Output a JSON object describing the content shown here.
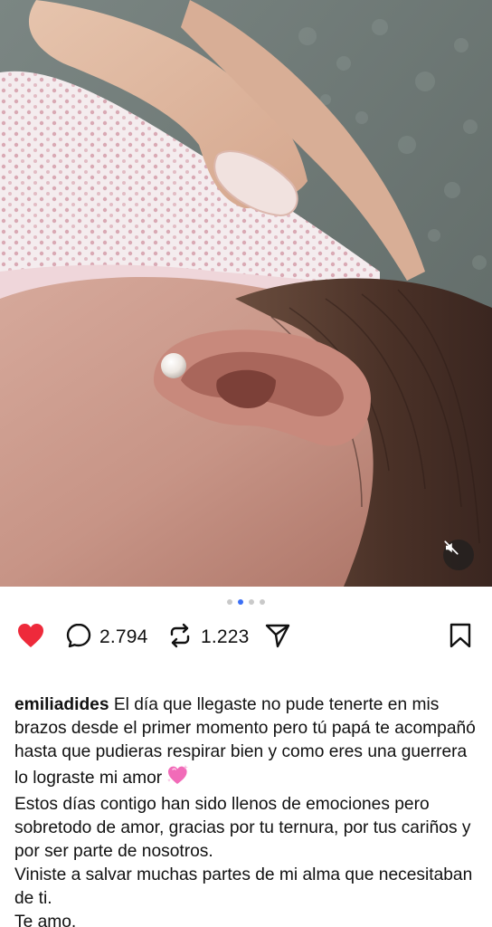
{
  "post": {
    "media": {
      "description_icon": "mute-icon",
      "carousel": {
        "count": 4,
        "active_index": 1
      }
    },
    "actions": {
      "like": {
        "icon": "heart-filled-icon",
        "color": "#ee2a3b",
        "liked": true
      },
      "comments": {
        "icon": "comment-icon",
        "count": "2.794"
      },
      "reposts": {
        "icon": "repost-icon",
        "count": "1.223"
      },
      "share": {
        "icon": "send-icon"
      },
      "save": {
        "icon": "bookmark-icon"
      }
    },
    "caption": {
      "username": "emiliadides",
      "line1": " El día que llegaste no pude tenerte en mis brazos desde el primer momento pero tú papá te acompañó hasta que pudieras respirar bien y como eres una guerrera lo lograste mi amor ",
      "emoji": "sparkling-heart-icon",
      "line2": "Estos días contigo han sido llenos de emociones pero sobretodo de amor, gracias por tu ternura, por tus cariños y por ser parte de nosotros.",
      "line3": "Viniste a salvar muchas partes de mi alma que necesitaban de ti.",
      "line4": "Te amo."
    },
    "colors": {
      "accent_dot": "#3b6ff5",
      "heart": "#ee2a3b",
      "text": "#111111"
    }
  }
}
